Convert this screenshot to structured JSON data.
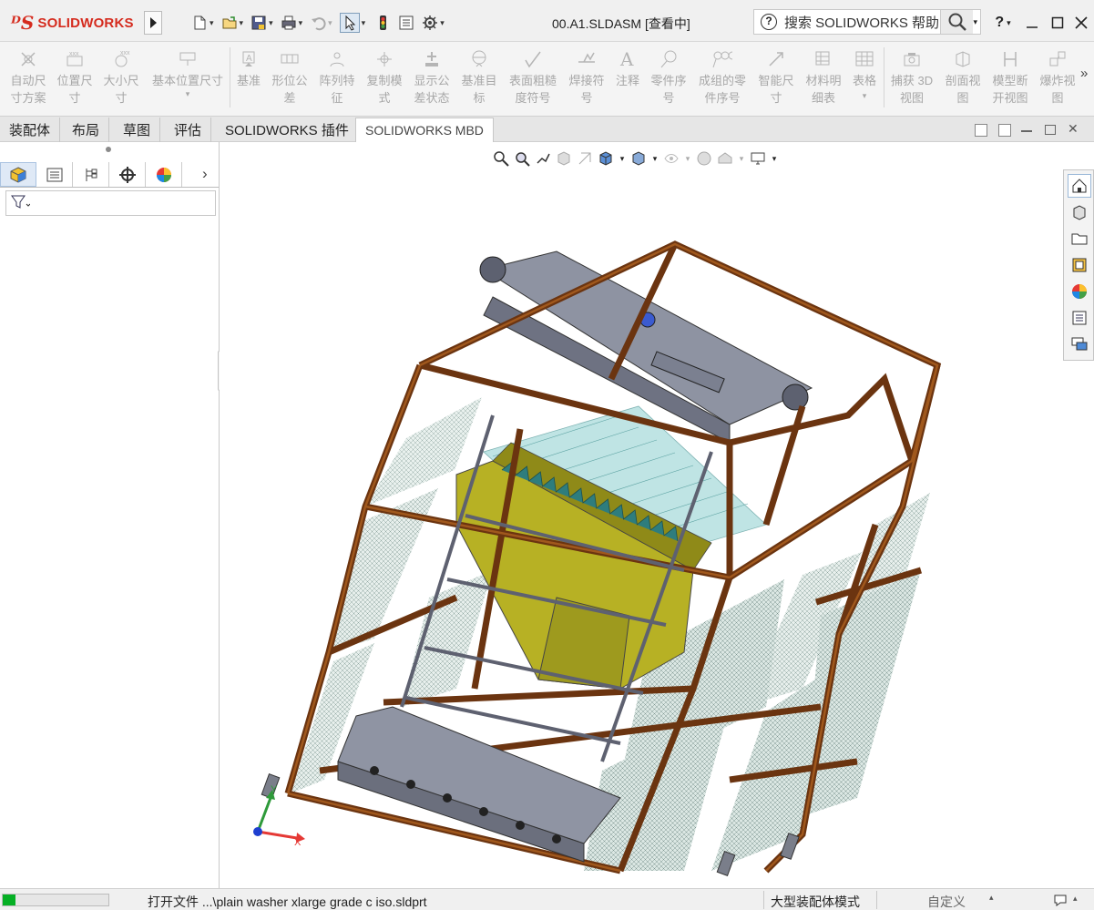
{
  "app": {
    "logo_text": "SOLIDWORKS",
    "document_title": "00.A1.SLDASM [查看中]",
    "help_search_placeholder": "搜索 SOLIDWORKS 帮助",
    "brand_color": "#d52b1e"
  },
  "quick_access": [
    "new-doc-icon",
    "open-icon",
    "save-icon",
    "print-icon",
    "undo-icon",
    "select-cursor-icon",
    "traffic-light-icon",
    "file-properties-icon",
    "options-gear-icon"
  ],
  "window_controls": [
    "help-question-icon",
    "minimize-icon",
    "maximize-icon",
    "close-icon"
  ],
  "command_manager": {
    "items": [
      {
        "label": "自动尺\n寸方案"
      },
      {
        "label": "位置尺\n寸"
      },
      {
        "label": "大小尺\n寸"
      },
      {
        "label": "基本位置尺寸"
      },
      {
        "label": "基准"
      },
      {
        "label": "形位公\n差"
      },
      {
        "label": "阵列特\n征"
      },
      {
        "label": "复制模\n式"
      },
      {
        "label": "显示公\n差状态"
      },
      {
        "label": "基准目\n标"
      },
      {
        "label": "表面粗糙\n度符号"
      },
      {
        "label": "焊接符\n号"
      },
      {
        "label": "注释"
      },
      {
        "label": "零件序\n号"
      },
      {
        "label": "成组的零\n件序号"
      },
      {
        "label": "智能尺\n寸"
      },
      {
        "label": "材料明\n细表"
      },
      {
        "label": "表格"
      },
      {
        "label": "捕获 3D\n视图"
      },
      {
        "label": "剖面视\n图"
      },
      {
        "label": "模型断\n开视图"
      },
      {
        "label": "爆炸视\n图"
      }
    ],
    "more": "»"
  },
  "tabs": [
    {
      "label": "装配体"
    },
    {
      "label": "布局"
    },
    {
      "label": "草图"
    },
    {
      "label": "评估"
    },
    {
      "label": "SOLIDWORKS 插件"
    },
    {
      "label": "SOLIDWORKS MBD"
    }
  ],
  "active_tab": "SOLIDWORKS MBD",
  "feature_manager": {
    "tabs": [
      "feature-tree-icon",
      "property-manager-icon",
      "configuration-manager-icon",
      "dimxpert-icon",
      "display-manager-icon"
    ],
    "more": "›"
  },
  "model": {
    "frame_color": "#7a3e12",
    "hopper_color": "#9e9a1e",
    "mesh_color": "#cfe1dc",
    "steel_color": "#9a9aa6",
    "triad_axes": [
      "X",
      "Y",
      "Z"
    ]
  },
  "status_bar": {
    "progress": 0.12,
    "message": "打开文件  ...\\plain washer xlarge grade c  iso.sldprt",
    "mode": "大型装配体模式",
    "units": "自定义"
  }
}
